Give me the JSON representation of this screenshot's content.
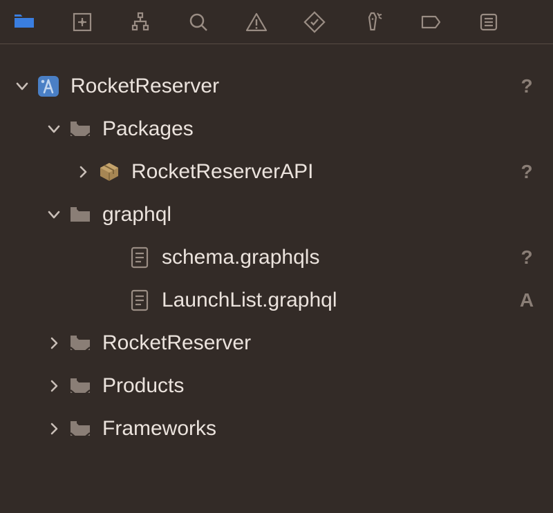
{
  "toolbar": {
    "tabs": [
      {
        "name": "project-navigator",
        "active": true
      },
      {
        "name": "source-control-navigator",
        "active": false
      },
      {
        "name": "symbol-navigator",
        "active": false
      },
      {
        "name": "find-navigator",
        "active": false
      },
      {
        "name": "issue-navigator",
        "active": false
      },
      {
        "name": "test-navigator",
        "active": false
      },
      {
        "name": "debug-navigator",
        "active": false
      },
      {
        "name": "breakpoint-navigator",
        "active": false
      },
      {
        "name": "report-navigator",
        "active": false
      }
    ]
  },
  "tree": [
    {
      "id": "root",
      "indent": 0,
      "disclosure": "down",
      "icon": "app-icon",
      "label": "RocketReserver",
      "status": "?"
    },
    {
      "id": "packages",
      "indent": 1,
      "disclosure": "down",
      "icon": "folder-ref-icon",
      "label": "Packages",
      "status": ""
    },
    {
      "id": "api",
      "indent": 2,
      "disclosure": "right",
      "icon": "package-icon",
      "label": "RocketReserverAPI",
      "status": "?"
    },
    {
      "id": "graphql",
      "indent": 1,
      "disclosure": "down",
      "icon": "folder-icon",
      "label": "graphql",
      "status": ""
    },
    {
      "id": "schema",
      "indent": 3,
      "disclosure": "none",
      "icon": "file-icon",
      "label": "schema.graphqls",
      "status": "?"
    },
    {
      "id": "launchlist",
      "indent": 3,
      "disclosure": "none",
      "icon": "file-icon",
      "label": "LaunchList.graphql",
      "status": "A"
    },
    {
      "id": "rocketfolder",
      "indent": 1,
      "disclosure": "right",
      "icon": "folder-ref-icon",
      "label": "RocketReserver",
      "status": ""
    },
    {
      "id": "products",
      "indent": 1,
      "disclosure": "right",
      "icon": "folder-ref-icon",
      "label": "Products",
      "status": ""
    },
    {
      "id": "frameworks",
      "indent": 1,
      "disclosure": "right",
      "icon": "folder-ref-icon",
      "label": "Frameworks",
      "status": ""
    }
  ]
}
